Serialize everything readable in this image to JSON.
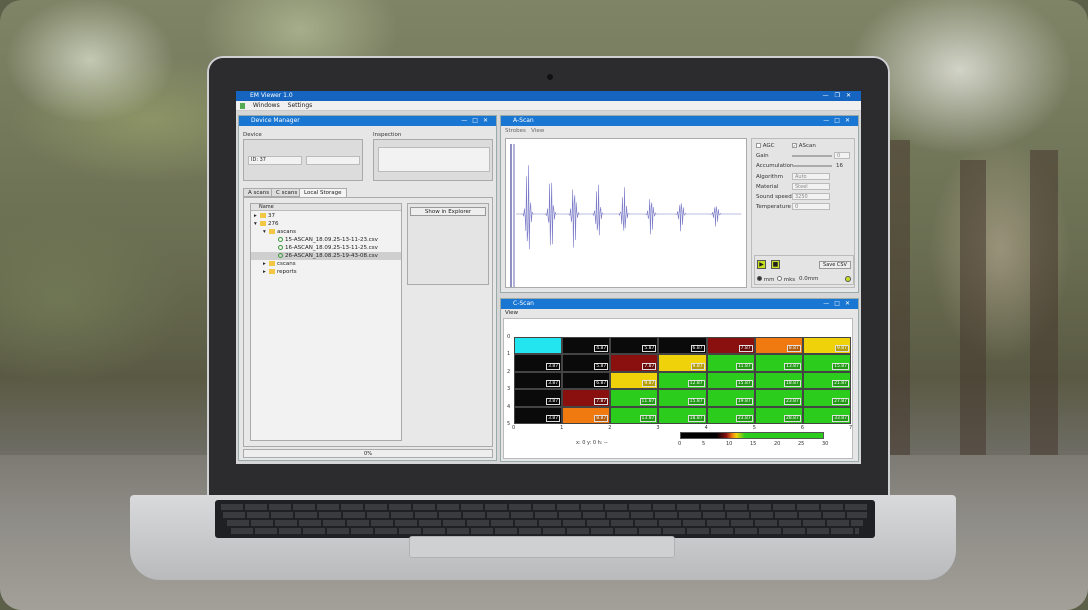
{
  "window": {
    "title": "EM Viewer 1.0",
    "menu": [
      "Windows",
      "Settings"
    ]
  },
  "device_manager": {
    "title": "Device Manager",
    "device_label": "Device",
    "device_id": "ID: 37",
    "inspection_label": "Inspection",
    "tabs": [
      "A scans",
      "C scans",
      "Local Storage"
    ],
    "active_tab": "Local Storage",
    "tree_header": "Name",
    "tree": [
      {
        "label": "37",
        "depth": 0,
        "type": "folder",
        "expanded": false
      },
      {
        "label": "276",
        "depth": 0,
        "type": "folder",
        "expanded": true
      },
      {
        "label": "ascans",
        "depth": 1,
        "type": "folder",
        "expanded": true
      },
      {
        "label": "15-ASCAN_18.09.25-13-11-23.csv",
        "depth": 2,
        "type": "file"
      },
      {
        "label": "16-ASCAN_18.09.25-13-11-25.csv",
        "depth": 2,
        "type": "file"
      },
      {
        "label": "26-ASCAN_18.08.25-19-43-08.csv",
        "depth": 2,
        "type": "file",
        "selected": true
      },
      {
        "label": "cscans",
        "depth": 1,
        "type": "folder",
        "expanded": false
      },
      {
        "label": "reports",
        "depth": 1,
        "type": "folder",
        "expanded": false
      }
    ],
    "show_button": "Show in Explorer",
    "progress": "0%"
  },
  "ascan": {
    "title": "A-Scan",
    "menu": [
      "Strobes",
      "View"
    ],
    "agc": "AGC",
    "ascan_check": "AScan",
    "gain_label": "Gain",
    "gain_value": "0",
    "accum_label": "Accumulation",
    "accum_value": "16",
    "algo_label": "Algorithm",
    "algo_value": "Auto",
    "material_label": "Material",
    "material_value": "Steel",
    "speed_label": "Sound speed",
    "speed_value": "3250",
    "temp_label": "Temperature",
    "temp_value": "0",
    "save_csv": "Save CSV",
    "unit_mm": "mm",
    "unit_mks": "mks",
    "reading": "0.0mm"
  },
  "cscan": {
    "title": "C-Scan",
    "menu": "View",
    "x_ticks": [
      "0",
      "1",
      "2",
      "3",
      "4",
      "5",
      "6",
      "7"
    ],
    "y_ticks": [
      "0",
      "1",
      "2",
      "3",
      "4",
      "5"
    ],
    "coord": "x: 0 y: 0 h: --",
    "scale_ticks": [
      "0",
      "5",
      "10",
      "15",
      "20",
      "25",
      "30"
    ],
    "rows": [
      [
        {
          "c": "#22e5f0",
          "v": ""
        },
        {
          "c": "#0a0a0a",
          "v": "4.87"
        },
        {
          "c": "#0a0a0a",
          "v": "5.87"
        },
        {
          "c": "#0a0a0a",
          "v": "6.87"
        },
        {
          "c": "#8a0f0f",
          "v": "7.87"
        },
        {
          "c": "#f07a10",
          "v": "8.87"
        },
        {
          "c": "#f0d20a",
          "v": "9.87"
        }
      ],
      [
        {
          "c": "#0a0a0a",
          "v": "3.87"
        },
        {
          "c": "#0a0a0a",
          "v": "5.87"
        },
        {
          "c": "#8a0f0f",
          "v": "7.87"
        },
        {
          "c": "#f0d20a",
          "v": "9.87"
        },
        {
          "c": "#2ccc1c",
          "v": "11.87"
        },
        {
          "c": "#2ccc1c",
          "v": "13.87"
        },
        {
          "c": "#2ccc1c",
          "v": "15.87"
        }
      ],
      [
        {
          "c": "#0a0a0a",
          "v": "3.87"
        },
        {
          "c": "#0a0a0a",
          "v": "6.87"
        },
        {
          "c": "#f0d20a",
          "v": "9.87"
        },
        {
          "c": "#2ccc1c",
          "v": "12.87"
        },
        {
          "c": "#2ccc1c",
          "v": "15.87"
        },
        {
          "c": "#2ccc1c",
          "v": "18.87"
        },
        {
          "c": "#2ccc1c",
          "v": "21.87"
        }
      ],
      [
        {
          "c": "#0a0a0a",
          "v": "3.87"
        },
        {
          "c": "#8a0f0f",
          "v": "7.87"
        },
        {
          "c": "#2ccc1c",
          "v": "11.87"
        },
        {
          "c": "#2ccc1c",
          "v": "15.87"
        },
        {
          "c": "#2ccc1c",
          "v": "19.87"
        },
        {
          "c": "#2ccc1c",
          "v": "23.87"
        },
        {
          "c": "#2ccc1c",
          "v": "27.87"
        }
      ],
      [
        {
          "c": "#0a0a0a",
          "v": "3.87"
        },
        {
          "c": "#f07a10",
          "v": "8.87"
        },
        {
          "c": "#2ccc1c",
          "v": "13.87"
        },
        {
          "c": "#2ccc1c",
          "v": "18.87"
        },
        {
          "c": "#2ccc1c",
          "v": "23.87"
        },
        {
          "c": "#2ccc1c",
          "v": "28.87"
        },
        {
          "c": "#2ccc1c",
          "v": "33.87"
        }
      ]
    ]
  }
}
